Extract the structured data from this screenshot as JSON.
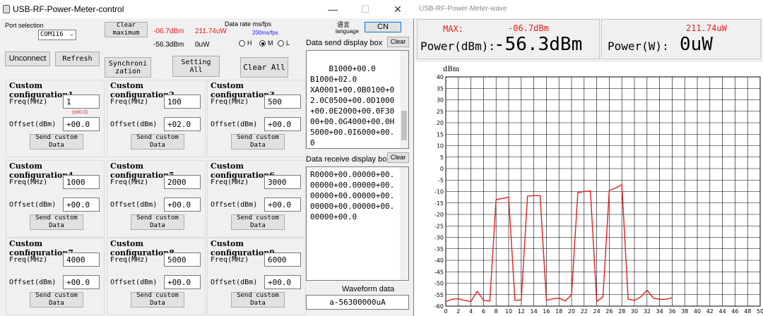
{
  "control": {
    "title": "USB-RF-Power-Meter-control",
    "port_selection_label": "Port selection",
    "port_value": "COM116",
    "clear_max_label": "Clear\nmaximum",
    "max_dbm": "-06.7dBm",
    "max_uw": "211.74uW",
    "cur_dbm": "-56.3dBm",
    "cur_uw": "0uW",
    "data_rate_label": "Data rate ms/fps",
    "data_rate_value": "200ms/fps",
    "radio_h": "H",
    "radio_m": "M",
    "radio_l": "L",
    "lang_label_cn": "语言",
    "lang_label": "language",
    "lang_button": "CN",
    "unconnect": "Unconnect",
    "refresh": "Refresh",
    "synchronization": "Synchroni\nzation",
    "setting_all": "Setting\nAll",
    "clear_all": "Clear All",
    "freq_label": "Freq(MHz)",
    "offset_label": "Offset(dBm)",
    "send_label": "Send custom\nData",
    "offset_hint": "(±00.0)",
    "configs": [
      {
        "title": "Custom configuration1",
        "freq": "1",
        "offset": "+00.0"
      },
      {
        "title": "Custom configuration2",
        "freq": "100",
        "offset": "+02.0"
      },
      {
        "title": "Custom configuration3",
        "freq": "500",
        "offset": "+00.0"
      },
      {
        "title": "Custom configuration4",
        "freq": "1000",
        "offset": "+00.0"
      },
      {
        "title": "Custom configuration5",
        "freq": "2000",
        "offset": "+00.0"
      },
      {
        "title": "Custom configuration6",
        "freq": "3000",
        "offset": "+00.0"
      },
      {
        "title": "Custom configuration7",
        "freq": "4000",
        "offset": "+00.0"
      },
      {
        "title": "Custom configuration8",
        "freq": "5000",
        "offset": "+00.0"
      },
      {
        "title": "Custom configuration9",
        "freq": "6000",
        "offset": "+00.0"
      }
    ],
    "send_box_label": "Data send display box",
    "send_box_clear": "Clear",
    "send_box_text": "B1000+00.0\nB1000+02.0\nXA0001+00.0B0100+02.0C0500+00.0D1000+00.0E2000+00.0F3000+00.0G4000+00.0H5000+00.0I6000+00.0\nC0500+00.0",
    "recv_box_label": "Data receive display box",
    "recv_box_clear": "Clear",
    "recv_box_text": "R0000+00.00000+00.00000+00.00000+00.00000+00.00000+00.00000+00.00000+00.00000+00.0",
    "waveform_label": "Waveform data",
    "waveform_value": "a-56300000uA"
  },
  "wave": {
    "title": "USB-RF-Power-Meter-wave",
    "max_label": "MAX:",
    "max_dbm": "-06.7dBm",
    "max_w": "211.74uW",
    "power_dbm_label": "Power(dBm):",
    "power_dbm_value": "-56.3dBm",
    "power_w_label": "Power(W):",
    "power_w_value": "0uW"
  },
  "chart_data": {
    "type": "line",
    "ylabel": "dBm",
    "xlim": [
      0,
      50
    ],
    "ylim": [
      -60,
      40
    ],
    "xticks": [
      0,
      2,
      4,
      6,
      8,
      10,
      12,
      14,
      16,
      18,
      20,
      22,
      24,
      26,
      28,
      30,
      32,
      34,
      36,
      38,
      40,
      42,
      44,
      46,
      48,
      50
    ],
    "yticks": [
      40,
      35,
      30,
      25,
      20,
      15,
      10,
      5,
      0,
      -5,
      -10,
      -15,
      -20,
      -25,
      -30,
      -35,
      -40,
      -45,
      -50,
      -55,
      -60
    ],
    "grid": true,
    "line_color": "#e02020",
    "x": [
      0,
      1,
      2,
      3,
      4,
      5,
      6,
      7,
      8,
      9,
      10,
      11,
      12,
      13,
      14,
      15,
      16,
      17,
      18,
      19,
      20,
      21,
      22,
      23,
      24,
      25,
      26,
      27,
      28,
      29,
      30,
      31,
      32,
      33,
      34,
      35,
      36
    ],
    "y": [
      -58,
      -57,
      -56.8,
      -57.5,
      -58,
      -53.5,
      -57.5,
      -57.8,
      -13.5,
      -13,
      -12.5,
      -57.5,
      -57.3,
      -12,
      -11.8,
      -11.8,
      -57.5,
      -56.8,
      -56.5,
      -57.8,
      -55,
      -10.5,
      -10,
      -9.8,
      -58,
      -56,
      -9.5,
      -8.5,
      -7,
      -57,
      -57.5,
      -56,
      -53,
      -56.5,
      -57,
      -57,
      -56.3
    ]
  }
}
